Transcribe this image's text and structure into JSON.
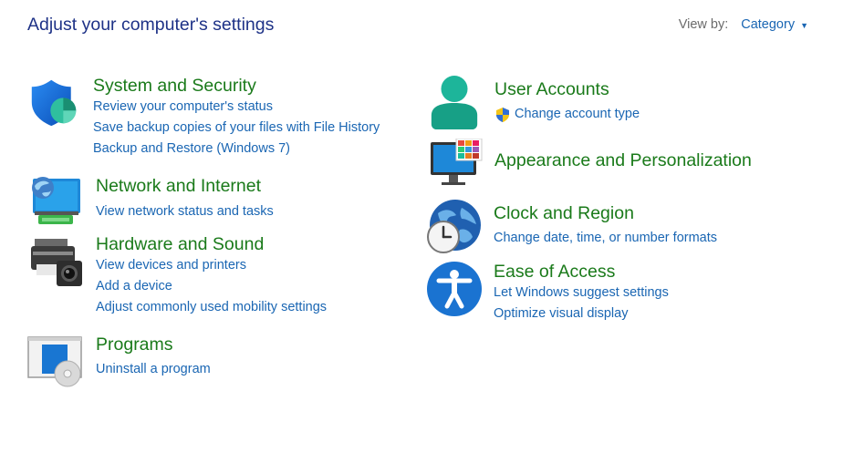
{
  "header": {
    "title": "Adjust your computer's settings",
    "view_by_label": "View by:",
    "view_by_value": "Category"
  },
  "categories": {
    "system": {
      "title": "System and Security",
      "links": [
        "Review your computer's status",
        "Save backup copies of your files with File History",
        "Backup and Restore (Windows 7)"
      ]
    },
    "network": {
      "title": "Network and Internet",
      "links": [
        "View network status and tasks"
      ]
    },
    "hardware": {
      "title": "Hardware and Sound",
      "links": [
        "View devices and printers",
        "Add a device",
        "Adjust commonly used mobility settings"
      ]
    },
    "programs": {
      "title": "Programs",
      "links": [
        "Uninstall a program"
      ]
    },
    "users": {
      "title": "User Accounts",
      "links": [
        "Change account type"
      ]
    },
    "appearance": {
      "title": "Appearance and Personalization",
      "links": []
    },
    "clock": {
      "title": "Clock and Region",
      "links": [
        "Change date, time, or number formats"
      ]
    },
    "ease": {
      "title": "Ease of Access",
      "links": [
        "Let Windows suggest settings",
        "Optimize visual display"
      ]
    }
  },
  "icons": {
    "system": "shield-icon",
    "network": "network-monitor-icon",
    "hardware": "printer-camera-icon",
    "programs": "programs-disc-icon",
    "users": "user-accounts-icon",
    "uac": "uac-shield-icon",
    "appearance": "appearance-monitor-icon",
    "clock": "globe-clock-icon",
    "ease": "accessibility-icon"
  },
  "colors": {
    "title": "#1e3287",
    "category_heading": "#1a7a1a",
    "link": "#1a66b3",
    "view_by_label": "#6b6b6b"
  }
}
